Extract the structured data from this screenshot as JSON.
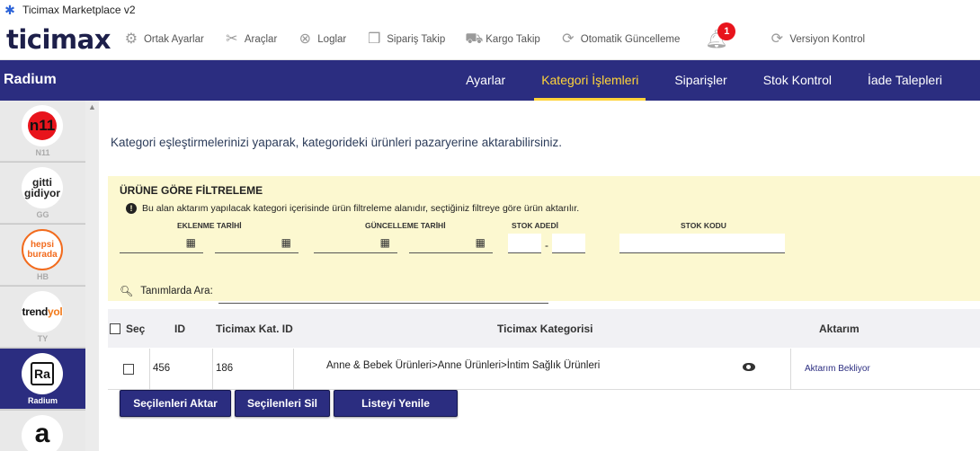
{
  "window": {
    "title": "Ticimax Marketplace v2"
  },
  "toolbar": {
    "logo": "ticimax",
    "items": [
      {
        "label": "Ortak Ayarlar",
        "icon": "gear-icon"
      },
      {
        "label": "Araçlar",
        "icon": "tools-icon"
      },
      {
        "label": "Loglar",
        "icon": "log-icon"
      },
      {
        "label": "Sipariş Takip",
        "icon": "box-icon"
      },
      {
        "label": "Kargo Takip",
        "icon": "truck-icon"
      },
      {
        "label": "Otomatik Güncelleme",
        "icon": "refresh-icon"
      }
    ],
    "notification_count": "1",
    "version_label": "Versiyon Kontrol"
  },
  "navbar": {
    "brand": "Radium",
    "links": [
      {
        "label": "Ayarlar",
        "active": false
      },
      {
        "label": "Kategori İşlemleri",
        "active": true
      },
      {
        "label": "Siparişler",
        "active": false
      },
      {
        "label": "Stok Kontrol",
        "active": false
      },
      {
        "label": "İade Talepleri",
        "active": false
      }
    ],
    "active_color": "#ffd43a",
    "bg_color": "#2b2d80"
  },
  "sidebar": {
    "markets": [
      {
        "code": "N11",
        "logo": "n11",
        "active": false
      },
      {
        "code": "GG",
        "logo_line1": "gitti",
        "logo_line2": "gidiyor",
        "active": false
      },
      {
        "code": "HB",
        "logo_line1": "hepsi",
        "logo_line2": "burada",
        "active": false
      },
      {
        "code": "TY",
        "logo": "trendyol",
        "active": false
      },
      {
        "code": "Radium",
        "logo": "Ra",
        "active": true
      },
      {
        "code": "",
        "logo": "a",
        "active": false
      }
    ]
  },
  "main": {
    "intro": "Kategori eşleştirmelerinizi yaparak, kategorideki ürünleri pazaryerine aktarabilirsiniz.",
    "filter": {
      "title": "ÜRÜNE GÖRE FİLTRELEME",
      "info": "Bu alan aktarım yapılacak kategori içerisinde ürün filtreleme alanıdır, seçtiğiniz filtreye göre ürün aktarılır.",
      "labels": {
        "eklenme": "EKLENME TARİHİ",
        "guncelleme": "GÜNCELLEME TARİHİ",
        "stok_adedi": "STOK ADEDİ",
        "stok_kodu": "STOK KODU"
      },
      "range_separator": "-"
    },
    "search": {
      "label": "Tanımlarda Ara:"
    },
    "table": {
      "headers": {
        "select": "Seç",
        "id": "ID",
        "ticimax_id": "Ticimax Kat. ID",
        "category": "Ticimax Kategorisi",
        "transfer": "Aktarım"
      },
      "rows": [
        {
          "id": "456",
          "ticimax_id": "186",
          "category": "Anne & Bebek Ürünleri>Anne Ürünleri>İntim Sağlık Ürünleri",
          "status": "Aktarım Bekliyor"
        }
      ]
    },
    "buttons": {
      "transfer_selected": "Seçilenleri Aktar",
      "delete_selected": "Seçilenleri Sil",
      "refresh_list": "Listeyi Yenile"
    }
  }
}
